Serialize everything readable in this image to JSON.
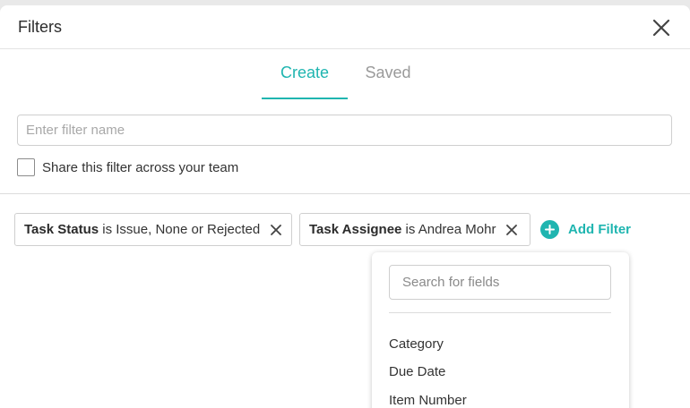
{
  "modal": {
    "title": "Filters"
  },
  "tabs": [
    {
      "label": "Create",
      "active": true
    },
    {
      "label": "Saved",
      "active": false
    }
  ],
  "filter_name": {
    "placeholder": "Enter filter name",
    "value": ""
  },
  "share": {
    "label": "Share this filter across your team",
    "checked": false
  },
  "filters": [
    {
      "field": "Task Status",
      "rest": " is Issue, None or Rejected"
    },
    {
      "field": "Task Assignee",
      "rest": " is Andrea Mohr"
    }
  ],
  "add_filter": {
    "label": "Add Filter"
  },
  "field_dropdown": {
    "search_placeholder": "Search for fields",
    "items": [
      "Category",
      "Due Date",
      "Item Number"
    ]
  },
  "colors": {
    "accent": "#1fb5b0",
    "border": "#cfcfcf",
    "text": "#333333"
  },
  "icons": {
    "close": "close-icon",
    "chip_remove": "x-icon",
    "add": "plus-circle-icon"
  }
}
